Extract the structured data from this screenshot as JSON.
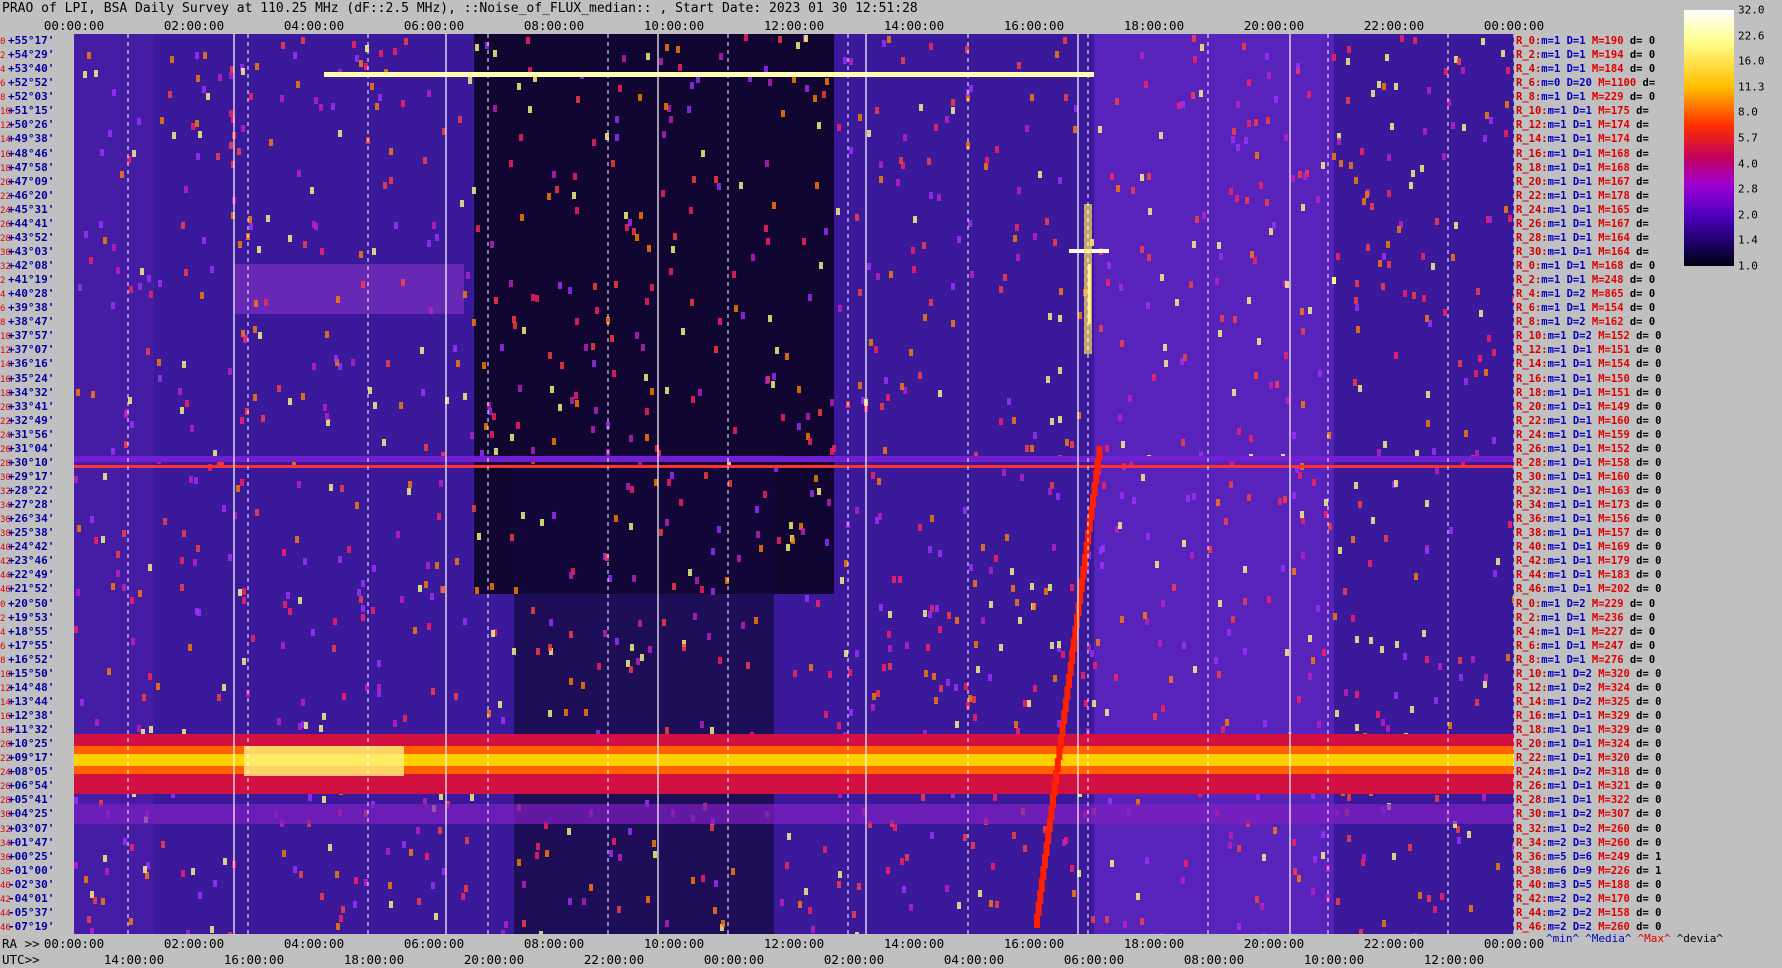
{
  "title": "PRAO of LPI, BSA Daily Survey at 110.25 MHz (dF::2.5 MHz), ::Noise_of_FLUX_median:: , Start Date: 2023 01 30 12:51:28",
  "colors": {
    "background": "#c0c0c0",
    "plot_bg": "#1a0d55",
    "index_red": "#e00000",
    "label_blue": "#0000a0"
  },
  "chart_data": {
    "type": "heatmap",
    "top_axis_ticks": [
      "00:00:00",
      "02:00:00",
      "04:00:00",
      "06:00:00",
      "08:00:00",
      "10:00:00",
      "12:00:00",
      "14:00:00",
      "16:00:00",
      "18:00:00",
      "20:00:00",
      "22:00:00",
      "00:00:00"
    ],
    "ra_label": "RA >>",
    "ra_ticks": [
      "00:00:00",
      "02:00:00",
      "04:00:00",
      "06:00:00",
      "08:00:00",
      "10:00:00",
      "12:00:00",
      "14:00:00",
      "16:00:00",
      "18:00:00",
      "20:00:00",
      "22:00:00",
      "00:00:00"
    ],
    "utc_label": "UTC>>",
    "utc_ticks": [
      "14:00:00",
      "16:00:00",
      "18:00:00",
      "20:00:00",
      "22:00:00",
      "00:00:00",
      "02:00:00",
      "04:00:00",
      "06:00:00",
      "08:00:00",
      "10:00:00",
      "12:00:00"
    ],
    "colorbar": {
      "ticks": [
        "32.0",
        "22.6",
        "16.0",
        "11.3",
        "8.0",
        "5.7",
        "4.0",
        "2.8",
        "2.0",
        "1.4",
        "1.0"
      ]
    },
    "declinations": [
      {
        "i": "0",
        "d": "+55°17'"
      },
      {
        "i": "2",
        "d": "+54°29'"
      },
      {
        "i": "4",
        "d": "+53°40'"
      },
      {
        "i": "6",
        "d": "+52°52'"
      },
      {
        "i": "8",
        "d": "+52°03'"
      },
      {
        "i": "10",
        "d": "+51°15'"
      },
      {
        "i": "12",
        "d": "+50°26'"
      },
      {
        "i": "14",
        "d": "+49°38'"
      },
      {
        "i": "16",
        "d": "+48°46'"
      },
      {
        "i": "18",
        "d": "+47°58'"
      },
      {
        "i": "20",
        "d": "+47°09'"
      },
      {
        "i": "22",
        "d": "+46°20'"
      },
      {
        "i": "24",
        "d": "+45°31'"
      },
      {
        "i": "26",
        "d": "+44°41'"
      },
      {
        "i": "28",
        "d": "+43°52'"
      },
      {
        "i": "30",
        "d": "+43°03'"
      },
      {
        "i": "32",
        "d": "+42°08'"
      },
      {
        "i": "2",
        "d": "+41°19'"
      },
      {
        "i": "4",
        "d": "+40°28'"
      },
      {
        "i": "6",
        "d": "+39°38'"
      },
      {
        "i": "8",
        "d": "+38°47'"
      },
      {
        "i": "10",
        "d": "+37°57'"
      },
      {
        "i": "12",
        "d": "+37°07'"
      },
      {
        "i": "14",
        "d": "+36°16'"
      },
      {
        "i": "16",
        "d": "+35°24'"
      },
      {
        "i": "18",
        "d": "+34°32'"
      },
      {
        "i": "20",
        "d": "+33°41'"
      },
      {
        "i": "22",
        "d": "+32°49'"
      },
      {
        "i": "24",
        "d": "+31°56'"
      },
      {
        "i": "26",
        "d": "+31°04'"
      },
      {
        "i": "28",
        "d": "+30°10'"
      },
      {
        "i": "30",
        "d": "+29°17'"
      },
      {
        "i": "32",
        "d": "+28°22'"
      },
      {
        "i": "34",
        "d": "+27°28'"
      },
      {
        "i": "36",
        "d": "+26°34'"
      },
      {
        "i": "38",
        "d": "+25°38'"
      },
      {
        "i": "40",
        "d": "+24°42'"
      },
      {
        "i": "42",
        "d": "+23°46'"
      },
      {
        "i": "44",
        "d": "+22°49'"
      },
      {
        "i": "46",
        "d": "+21°52'"
      },
      {
        "i": "0",
        "d": "+20°50'"
      },
      {
        "i": "2",
        "d": "+19°53'"
      },
      {
        "i": "4",
        "d": "+18°55'"
      },
      {
        "i": "6",
        "d": "+17°55'"
      },
      {
        "i": "8",
        "d": "+16°52'"
      },
      {
        "i": "10",
        "d": "+15°50'"
      },
      {
        "i": "12",
        "d": "+14°48'"
      },
      {
        "i": "14",
        "d": "+13°44'"
      },
      {
        "i": "16",
        "d": "+12°38'"
      },
      {
        "i": "18",
        "d": "+11°32'"
      },
      {
        "i": "20",
        "d": "+10°25'"
      },
      {
        "i": "22",
        "d": "+09°17'"
      },
      {
        "i": "24",
        "d": "+08°05'"
      },
      {
        "i": "26",
        "d": "+06°54'"
      },
      {
        "i": "28",
        "d": "+05°41'"
      },
      {
        "i": "30",
        "d": "+04°25'"
      },
      {
        "i": "32",
        "d": "+03°07'"
      },
      {
        "i": "34",
        "d": "+01°47'"
      },
      {
        "i": "36",
        "d": "+00°25'"
      },
      {
        "i": "38",
        "d": "-01°00'"
      },
      {
        "i": "40",
        "d": "-02°30'"
      },
      {
        "i": "42",
        "d": "-04°01'"
      },
      {
        "i": "44",
        "d": "-05°37'"
      },
      {
        "i": "46",
        "d": "-07°19'"
      }
    ],
    "beam_stats": [
      {
        "r": "R_0:",
        "m": "1",
        "D": "1",
        "M": "190",
        "d": "0"
      },
      {
        "r": "R_2:",
        "m": "1",
        "D": "1",
        "M": "194",
        "d": "0"
      },
      {
        "r": "R_4:",
        "m": "1",
        "D": "1",
        "M": "184",
        "d": "0"
      },
      {
        "r": "R_6:",
        "m": "0",
        "D": "20",
        "M": "1100",
        "d": ""
      },
      {
        "r": "R_8:",
        "m": "1",
        "D": "1",
        "M": "229",
        "d": "0"
      },
      {
        "r": "R_10:",
        "m": "1",
        "D": "1",
        "M": "175",
        "d": ""
      },
      {
        "r": "R_12:",
        "m": "1",
        "D": "1",
        "M": "174",
        "d": ""
      },
      {
        "r": "R_14:",
        "m": "1",
        "D": "1",
        "M": "174",
        "d": ""
      },
      {
        "r": "R_16:",
        "m": "1",
        "D": "1",
        "M": "168",
        "d": ""
      },
      {
        "r": "R_18:",
        "m": "1",
        "D": "1",
        "M": "168",
        "d": ""
      },
      {
        "r": "R_20:",
        "m": "1",
        "D": "1",
        "M": "167",
        "d": ""
      },
      {
        "r": "R_22:",
        "m": "1",
        "D": "1",
        "M": "178",
        "d": ""
      },
      {
        "r": "R_24:",
        "m": "1",
        "D": "1",
        "M": "165",
        "d": ""
      },
      {
        "r": "R_26:",
        "m": "1",
        "D": "1",
        "M": "167",
        "d": ""
      },
      {
        "r": "R_28:",
        "m": "1",
        "D": "1",
        "M": "164",
        "d": ""
      },
      {
        "r": "R_30:",
        "m": "1",
        "D": "1",
        "M": "164",
        "d": ""
      },
      {
        "r": "R_0:",
        "m": "1",
        "D": "1",
        "M": "168",
        "d": "0"
      },
      {
        "r": "R_2:",
        "m": "1",
        "D": "1",
        "M": "248",
        "d": "0"
      },
      {
        "r": "R_4:",
        "m": "1",
        "D": "2",
        "M": "865",
        "d": "0"
      },
      {
        "r": "R_6:",
        "m": "1",
        "D": "1",
        "M": "154",
        "d": "0"
      },
      {
        "r": "R_8:",
        "m": "1",
        "D": "2",
        "M": "162",
        "d": "0"
      },
      {
        "r": "R_10:",
        "m": "1",
        "D": "2",
        "M": "152",
        "d": "0"
      },
      {
        "r": "R_12:",
        "m": "1",
        "D": "1",
        "M": "151",
        "d": "0"
      },
      {
        "r": "R_14:",
        "m": "1",
        "D": "1",
        "M": "154",
        "d": "0"
      },
      {
        "r": "R_16:",
        "m": "1",
        "D": "1",
        "M": "150",
        "d": "0"
      },
      {
        "r": "R_18:",
        "m": "1",
        "D": "1",
        "M": "151",
        "d": "0"
      },
      {
        "r": "R_20:",
        "m": "1",
        "D": "1",
        "M": "149",
        "d": "0"
      },
      {
        "r": "R_22:",
        "m": "1",
        "D": "1",
        "M": "160",
        "d": "0"
      },
      {
        "r": "R_24:",
        "m": "1",
        "D": "1",
        "M": "159",
        "d": "0"
      },
      {
        "r": "R_26:",
        "m": "1",
        "D": "1",
        "M": "152",
        "d": "0"
      },
      {
        "r": "R_28:",
        "m": "1",
        "D": "1",
        "M": "158",
        "d": "0"
      },
      {
        "r": "R_30:",
        "m": "1",
        "D": "1",
        "M": "160",
        "d": "0"
      },
      {
        "r": "R_32:",
        "m": "1",
        "D": "1",
        "M": "163",
        "d": "0"
      },
      {
        "r": "R_34:",
        "m": "1",
        "D": "1",
        "M": "173",
        "d": "0"
      },
      {
        "r": "R_36:",
        "m": "1",
        "D": "1",
        "M": "156",
        "d": "0"
      },
      {
        "r": "R_38:",
        "m": "1",
        "D": "1",
        "M": "157",
        "d": "0"
      },
      {
        "r": "R_40:",
        "m": "1",
        "D": "1",
        "M": "169",
        "d": "0"
      },
      {
        "r": "R_42:",
        "m": "1",
        "D": "1",
        "M": "179",
        "d": "0"
      },
      {
        "r": "R_44:",
        "m": "1",
        "D": "1",
        "M": "183",
        "d": "0"
      },
      {
        "r": "R_46:",
        "m": "1",
        "D": "1",
        "M": "202",
        "d": "0"
      },
      {
        "r": "R_0:",
        "m": "1",
        "D": "2",
        "M": "229",
        "d": "0"
      },
      {
        "r": "R_2:",
        "m": "1",
        "D": "1",
        "M": "236",
        "d": "0"
      },
      {
        "r": "R_4:",
        "m": "1",
        "D": "1",
        "M": "227",
        "d": "0"
      },
      {
        "r": "R_6:",
        "m": "1",
        "D": "1",
        "M": "247",
        "d": "0"
      },
      {
        "r": "R_8:",
        "m": "1",
        "D": "1",
        "M": "276",
        "d": "0"
      },
      {
        "r": "R_10:",
        "m": "1",
        "D": "2",
        "M": "320",
        "d": "0"
      },
      {
        "r": "R_12:",
        "m": "1",
        "D": "2",
        "M": "324",
        "d": "0"
      },
      {
        "r": "R_14:",
        "m": "1",
        "D": "2",
        "M": "325",
        "d": "0"
      },
      {
        "r": "R_16:",
        "m": "1",
        "D": "1",
        "M": "329",
        "d": "0"
      },
      {
        "r": "R_18:",
        "m": "1",
        "D": "1",
        "M": "329",
        "d": "0"
      },
      {
        "r": "R_20:",
        "m": "1",
        "D": "1",
        "M": "324",
        "d": "0"
      },
      {
        "r": "R_22:",
        "m": "1",
        "D": "1",
        "M": "320",
        "d": "0"
      },
      {
        "r": "R_24:",
        "m": "1",
        "D": "2",
        "M": "318",
        "d": "0"
      },
      {
        "r": "R_26:",
        "m": "1",
        "D": "1",
        "M": "321",
        "d": "0"
      },
      {
        "r": "R_28:",
        "m": "1",
        "D": "1",
        "M": "322",
        "d": "0"
      },
      {
        "r": "R_30:",
        "m": "1",
        "D": "2",
        "M": "307",
        "d": "0"
      },
      {
        "r": "R_32:",
        "m": "1",
        "D": "2",
        "M": "260",
        "d": "0"
      },
      {
        "r": "R_34:",
        "m": "2",
        "D": "3",
        "M": "260",
        "d": "0"
      },
      {
        "r": "R_36:",
        "m": "5",
        "D": "6",
        "M": "249",
        "d": "1"
      },
      {
        "r": "R_38:",
        "m": "6",
        "D": "9",
        "M": "226",
        "d": "1"
      },
      {
        "r": "R_40:",
        "m": "3",
        "D": "5",
        "M": "188",
        "d": "0"
      },
      {
        "r": "R_42:",
        "m": "2",
        "D": "2",
        "M": "170",
        "d": "0"
      },
      {
        "r": "R_44:",
        "m": "2",
        "D": "2",
        "M": "158",
        "d": "0"
      },
      {
        "r": "R_46:",
        "m": "2",
        "D": "2",
        "M": "260",
        "d": "0"
      }
    ],
    "legend": [
      "^min^",
      "^Media^",
      "^Max^",
      "^devia^"
    ]
  }
}
